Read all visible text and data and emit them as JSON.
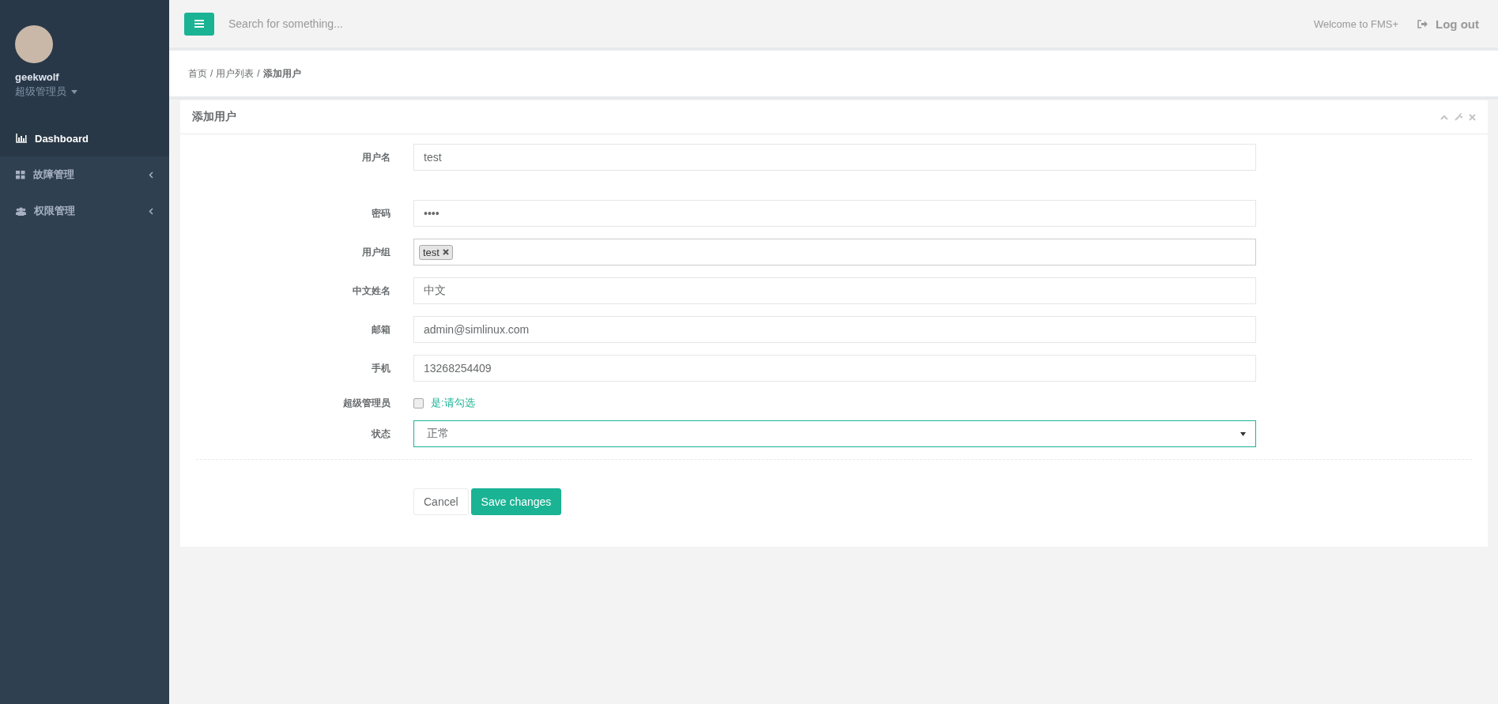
{
  "sidebar": {
    "user": {
      "name": "geekwolf",
      "role": "超级管理员"
    },
    "items": [
      {
        "label": "Dashboard",
        "selected": true,
        "has_submenu": false
      },
      {
        "label": "故障管理",
        "selected": false,
        "has_submenu": true
      },
      {
        "label": "权限管理",
        "selected": false,
        "has_submenu": true
      }
    ]
  },
  "header": {
    "search": {
      "placeholder": "Search for something..."
    },
    "welcome": "Welcome to FMS+",
    "logout": "Log out"
  },
  "breadcrumb": [
    {
      "kind": "link",
      "label": "首页"
    },
    {
      "kind": "separator",
      "label": "/"
    },
    {
      "kind": "link",
      "label": "用户列表"
    },
    {
      "kind": "separator",
      "label": "/"
    },
    {
      "kind": "current",
      "label": "添加用户"
    }
  ],
  "card": {
    "title": "添加用户",
    "fields": [
      {
        "kind": "text",
        "label": "用户名",
        "value": "test"
      },
      {
        "kind": "gap"
      },
      {
        "kind": "text",
        "label": "密码",
        "value": "••••"
      },
      {
        "kind": "tags",
        "label": "用户组",
        "tags": [
          "test"
        ]
      },
      {
        "kind": "text",
        "label": "中文姓名",
        "value": "中文"
      },
      {
        "kind": "text",
        "label": "邮箱",
        "value": "admin@simlinux.com"
      },
      {
        "kind": "text",
        "label": "手机",
        "value": "13268254409"
      },
      {
        "kind": "checkbox",
        "label": "超级管理员",
        "text": "是:请勾选",
        "checked": false
      },
      {
        "kind": "select",
        "label": "状态",
        "value": "正常"
      }
    ],
    "buttons": [
      {
        "label": "Cancel",
        "primary": false
      },
      {
        "label": "Save changes",
        "primary": true
      }
    ]
  }
}
